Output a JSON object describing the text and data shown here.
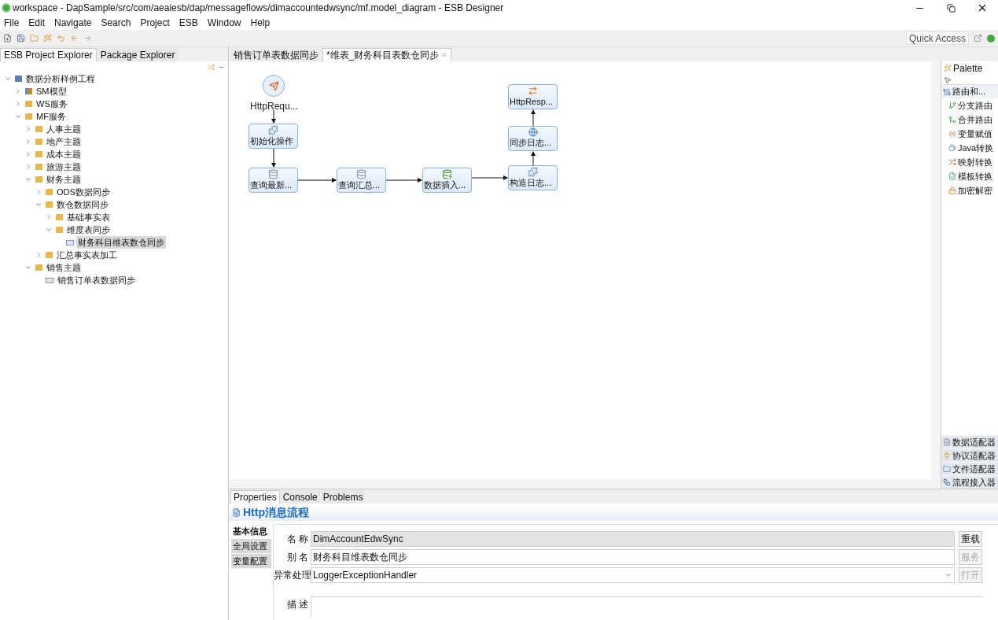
{
  "window": {
    "title": "workspace - DapSample/src/com/aeaiesb/dap/messageflows/dimaccountedwsync/mf.model_diagram - ESB Designer"
  },
  "menu": [
    "File",
    "Edit",
    "Navigate",
    "Search",
    "Project",
    "ESB",
    "Window",
    "Help"
  ],
  "toolbar": {
    "quick_access": "Quick Access"
  },
  "explorer": {
    "tabs": [
      {
        "label": "ESB Project Explorer",
        "selected": true
      },
      {
        "label": "Package Explorer",
        "selected": false
      }
    ],
    "tree": [
      {
        "label": "数据分析样例工程",
        "kind": "project",
        "expanded": true,
        "selected": false,
        "children": [
          {
            "label": "SM模型",
            "kind": "model",
            "expanded": false,
            "selected": false
          },
          {
            "label": "WS服务",
            "kind": "folder",
            "expanded": false,
            "selected": false
          },
          {
            "label": "MF服务",
            "kind": "folder",
            "expanded": true,
            "selected": false,
            "children": [
              {
                "label": "人事主题",
                "kind": "folder",
                "expanded": false,
                "selected": false
              },
              {
                "label": "地产主题",
                "kind": "folder",
                "expanded": false,
                "selected": false
              },
              {
                "label": "成本主题",
                "kind": "folder",
                "expanded": false,
                "selected": false
              },
              {
                "label": "旅游主题",
                "kind": "folder",
                "expanded": false,
                "selected": false
              },
              {
                "label": "财务主题",
                "kind": "folder",
                "expanded": true,
                "selected": false,
                "children": [
                  {
                    "label": "ODS数据同步",
                    "kind": "folder",
                    "expanded": false,
                    "selected": false
                  },
                  {
                    "label": "数仓数据同步",
                    "kind": "folder",
                    "expanded": true,
                    "selected": false,
                    "children": [
                      {
                        "label": "基础事实表",
                        "kind": "folder",
                        "expanded": false,
                        "selected": false
                      },
                      {
                        "label": "维度表同步",
                        "kind": "folder",
                        "expanded": true,
                        "selected": false,
                        "children": [
                          {
                            "label": "财务科目维表数仓同步",
                            "kind": "flow",
                            "selected": true
                          }
                        ]
                      }
                    ]
                  },
                  {
                    "label": "汇总事实表加工",
                    "kind": "folder",
                    "expanded": false,
                    "selected": false
                  }
                ]
              },
              {
                "label": "销售主题",
                "kind": "folder",
                "expanded": true,
                "selected": false,
                "children": [
                  {
                    "label": "销售订单表数据同步",
                    "kind": "flow",
                    "selected": false
                  }
                ]
              }
            ]
          }
        ]
      }
    ]
  },
  "editor": {
    "tabs": [
      {
        "label": "销售订单表数据同步",
        "selected": false
      },
      {
        "label": "*维表_财务科目表数仓同步",
        "selected": true
      }
    ],
    "nodes": [
      {
        "label": "HttpRequ...",
        "kind": "request"
      },
      {
        "label": "初始化操作",
        "kind": "script"
      },
      {
        "label": "查询最新...",
        "kind": "query"
      },
      {
        "label": "查询汇总...",
        "kind": "query"
      },
      {
        "label": "数据插入...",
        "kind": "insert"
      },
      {
        "label": "HttpResp...",
        "kind": "response"
      },
      {
        "label": "同步日志...",
        "kind": "log"
      },
      {
        "label": "构造日志...",
        "kind": "script"
      }
    ]
  },
  "palette": {
    "title": "Palette",
    "drawer": {
      "label": "路由和...",
      "items": [
        "分支路由",
        "合并路由",
        "变量赋值",
        "Java转换",
        "映射转换",
        "模板转换",
        "加密解密"
      ]
    },
    "bottom_drawers": [
      "数据适配器",
      "协议适配器",
      "文件适配器",
      "流程接入器"
    ]
  },
  "properties": {
    "tabs": [
      {
        "label": "Properties",
        "selected": true
      },
      {
        "label": "Console",
        "selected": false
      },
      {
        "label": "Problems",
        "selected": false
      }
    ],
    "title": "Http消息流程",
    "side_tabs": [
      {
        "label": "基本信息",
        "selected": true
      },
      {
        "label": "全局设置",
        "selected": false
      },
      {
        "label": "变量配置",
        "selected": false
      }
    ],
    "fields": [
      {
        "label": "名 称",
        "kind": "text",
        "value": "DimAccountEdwSync",
        "readonly": true,
        "button": {
          "label": "重载",
          "disabled": false
        }
      },
      {
        "label": "别 名",
        "kind": "text",
        "value": "财务科目维表数仓同步",
        "readonly": false,
        "button": {
          "label": "服务",
          "disabled": true
        }
      },
      {
        "label": "异常处理",
        "kind": "select",
        "value": "LoggerExceptionHandler",
        "button": {
          "label": "打开",
          "disabled": true
        }
      },
      {
        "label": "描 述",
        "kind": "textarea"
      }
    ]
  }
}
